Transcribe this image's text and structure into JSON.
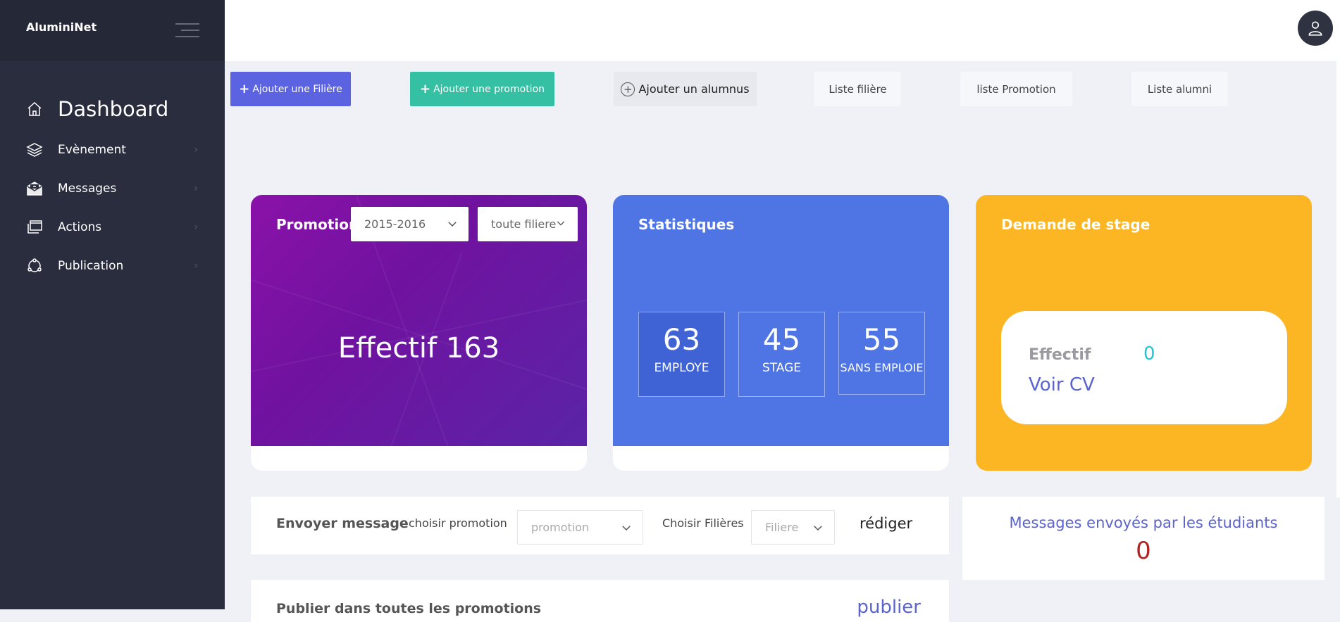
{
  "brand": "AluminiNet",
  "sidebar": {
    "items": [
      {
        "label": "Dashboard"
      },
      {
        "label": "Evènement"
      },
      {
        "label": "Messages"
      },
      {
        "label": "Actions"
      },
      {
        "label": "Publication"
      }
    ]
  },
  "toolbar": {
    "add_filiere": "Ajouter une Filière",
    "add_promotion": "Ajouter une promotion",
    "add_alumnus": "Ajouter un alumnus",
    "list_filiere": "Liste filière",
    "list_promotion": "liste Promotion",
    "list_alumni": "Liste alumni"
  },
  "promotion_card": {
    "label": "Promotion",
    "year_select": "2015-2016",
    "filiere_select": "toute filiere",
    "effectif": "Effectif 163"
  },
  "stats_card": {
    "title": "Statistiques",
    "stats": [
      {
        "value": "63",
        "label": "EMPLOYE"
      },
      {
        "value": "45",
        "label": "STAGE"
      },
      {
        "value": "55",
        "label": "SANS EMPLOIE"
      }
    ]
  },
  "stage_card": {
    "title": "Demande de stage",
    "effectif_label": "Effectif",
    "effectif_value": "0",
    "cv_link": "Voir CV"
  },
  "message_row": {
    "title": "Envoyer message",
    "choose_promotion": "choisir promotion",
    "promotion_placeholder": "promotion",
    "choose_filieres": "Choisir Filières",
    "filiere_placeholder": "Filiere",
    "compose": "rédiger"
  },
  "sent_messages": {
    "title": "Messages envoyés par les étudiants",
    "count": "0"
  },
  "publish_row": {
    "title": "Publier dans toutes les promotions",
    "button": "publier"
  },
  "colors": {
    "sidebar": "#2a2d3e",
    "purple_card": "#7a12a4",
    "blue_card": "#4e75e3",
    "yellow_card": "#fdb623",
    "btn_blue": "#5b63e0",
    "btn_green": "#35bfa3"
  }
}
